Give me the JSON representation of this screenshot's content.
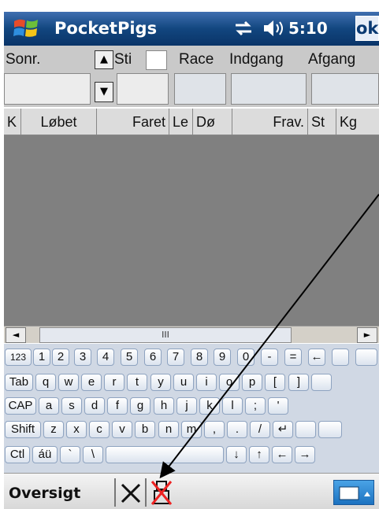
{
  "titlebar": {
    "app_title": "PocketPigs",
    "time": "5:10",
    "ok_label": "ok"
  },
  "form": {
    "labels": {
      "sonr": "Sonr.",
      "sti": "Sti",
      "race": "Race",
      "indgang": "Indgang",
      "afgang": "Afgang"
    },
    "spin_up": "▲",
    "spin_down": "▼",
    "values": {
      "sonr": "",
      "sti": "",
      "race": "",
      "indgang": "",
      "afgang": ""
    }
  },
  "columns": [
    "K",
    "Løbet",
    "Faret",
    "Le",
    "Dø",
    "Frav.",
    "St",
    "Kg"
  ],
  "scrollbar": {
    "left": "◄",
    "right": "►",
    "thumb": "III"
  },
  "keyboard": {
    "row1": [
      "123",
      "1",
      "2",
      "3",
      "4",
      "5",
      "6",
      "7",
      "8",
      "9",
      "0",
      "-",
      "=",
      "←"
    ],
    "row2": [
      "Tab",
      "q",
      "w",
      "e",
      "r",
      "t",
      "y",
      "u",
      "i",
      "o",
      "p",
      "[",
      "]"
    ],
    "row3": [
      "CAP",
      "a",
      "s",
      "d",
      "f",
      "g",
      "h",
      "j",
      "k",
      "l",
      ";",
      "'"
    ],
    "row4": [
      "Shift",
      "z",
      "x",
      "c",
      "v",
      "b",
      "n",
      "m",
      ",",
      ".",
      "/",
      "↵"
    ],
    "row5": [
      "Ctl",
      "áü",
      "`",
      "\\",
      "",
      "↓",
      "↑",
      "←",
      "→"
    ]
  },
  "bottombar": {
    "softkey_left": "Oversigt"
  },
  "colors": {
    "title_bg": "#12467f",
    "grid_bg": "#808080",
    "keyboard_bg": "#d0d8e4"
  }
}
